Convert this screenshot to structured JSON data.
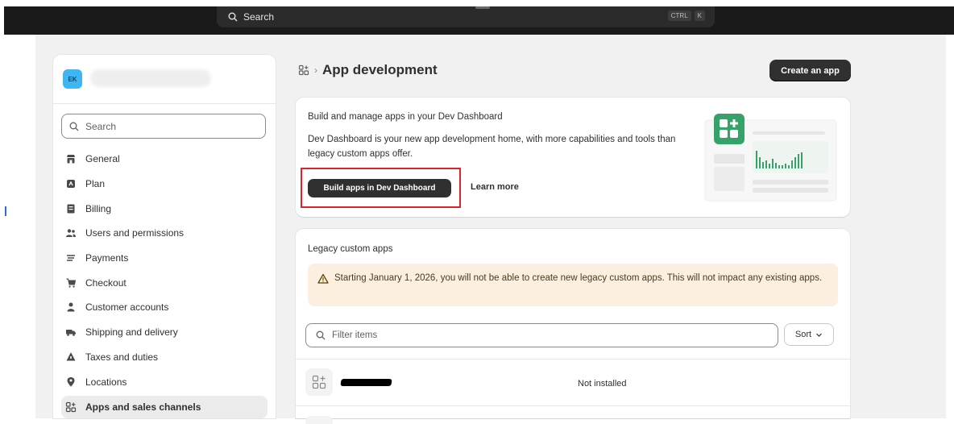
{
  "topbar": {
    "search_label": "Search",
    "shortcut_keys": [
      "CTRL",
      "K"
    ]
  },
  "sidebar": {
    "avatar_initials": "EK",
    "search_placeholder": "Search",
    "items": [
      {
        "label": "General",
        "icon": "store-icon"
      },
      {
        "label": "Plan",
        "icon": "plan-icon"
      },
      {
        "label": "Billing",
        "icon": "billing-icon"
      },
      {
        "label": "Users and permissions",
        "icon": "users-icon"
      },
      {
        "label": "Payments",
        "icon": "payments-icon"
      },
      {
        "label": "Checkout",
        "icon": "cart-icon"
      },
      {
        "label": "Customer accounts",
        "icon": "person-icon"
      },
      {
        "label": "Shipping and delivery",
        "icon": "truck-icon"
      },
      {
        "label": "Taxes and duties",
        "icon": "taxes-icon"
      },
      {
        "label": "Locations",
        "icon": "location-icon"
      },
      {
        "label": "Apps and sales channels",
        "icon": "apps-icon",
        "active": true
      }
    ]
  },
  "header": {
    "breadcrumb_separator": "›",
    "title": "App development",
    "create_button": "Create an app"
  },
  "dev_dashboard_card": {
    "heading": "Build and manage apps in your Dev Dashboard",
    "description": "Dev Dashboard is your new app development home, with more capabilities and tools than legacy custom apps offer.",
    "primary_button": "Build apps in Dev Dashboard",
    "secondary_link": "Learn more"
  },
  "legacy_card": {
    "heading": "Legacy custom apps",
    "banner_text": "Starting January 1, 2026, you will not be able to create new legacy custom apps. This will not impact any existing apps.",
    "filter_placeholder": "Filter items",
    "sort_label": "Sort",
    "apps": [
      {
        "status": "Not installed"
      }
    ]
  },
  "colors": {
    "topbar": "#1a1a1a",
    "primary_button": "#303030",
    "banner_bg": "#fcefe0",
    "highlight_box": "#e1222b",
    "illustration_green": "#36a269"
  }
}
